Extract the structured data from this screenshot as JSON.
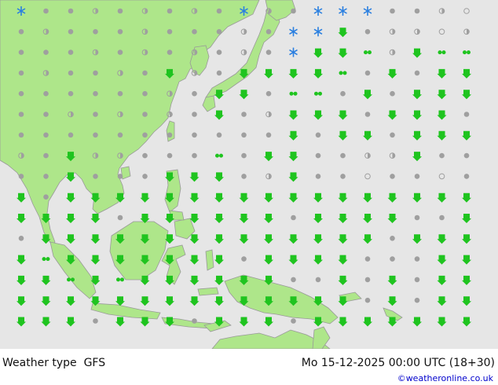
{
  "footer": {
    "label": "Weather type",
    "model": "GFS",
    "datetime": "Mo 15-12-2025 00:00 UTC (18+30)",
    "credit": "©weatheronline.co.uk"
  },
  "colors": {
    "sea": "#e6e6e6",
    "land": "#aee68a",
    "coast": "#999999",
    "rain": "#1fc41f",
    "snow": "#2a7fe0",
    "cloud": "#9f9f9f"
  },
  "legend_symbols": [
    "rain-shower-icon",
    "rain-icon",
    "drizzle-icon",
    "snow-icon",
    "cloudy-icon",
    "partly-cloudy-icon",
    "clear-icon"
  ]
}
